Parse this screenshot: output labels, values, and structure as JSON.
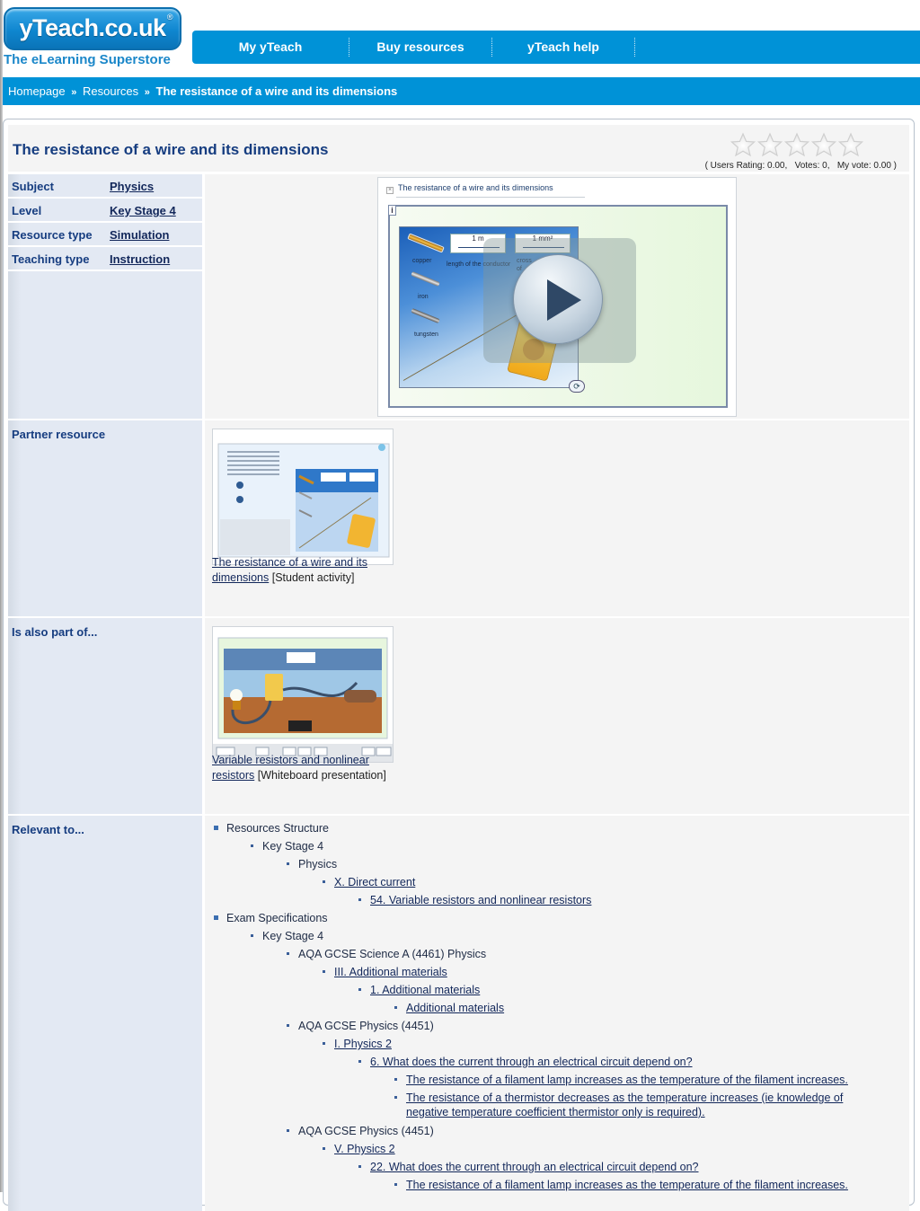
{
  "logo": {
    "text": "yTeach.co.uk",
    "reg": "®",
    "tagline": "The eLearning Superstore"
  },
  "topnav": {
    "items": [
      "My yTeach",
      "Buy resources",
      "yTeach help"
    ]
  },
  "breadcrumb": {
    "items": [
      "Homepage",
      "Resources"
    ],
    "separator": "»",
    "current": "The resistance of a wire and its dimensions"
  },
  "colors": {
    "brand_blue": "#0092d7",
    "title_navy": "#163d80",
    "label_bg": "#e3e9f3",
    "content_bg": "#f4f4f4"
  },
  "resource": {
    "title": "The resistance of a wire and its dimensions",
    "rating": {
      "stars_total": 5,
      "stars_filled": 0,
      "text": "( Users Rating: 0.00,   Votes: 0,   My vote: 0.00 )"
    },
    "properties": [
      {
        "label": "Subject",
        "value": "Physics"
      },
      {
        "label": "Level",
        "value": "Key Stage 4"
      },
      {
        "label": "Resource type",
        "value": "Simulation"
      },
      {
        "label": "Teaching type",
        "value": "Instruction"
      }
    ],
    "preview": {
      "title": "The resistance of a wire and its dimensions",
      "info_icon": "i",
      "materials": [
        "copper",
        "iron",
        "tungsten"
      ],
      "length_value": "1 m",
      "length_label": "length of the conductor",
      "area_value": "1 mm²",
      "area_label": "cross",
      "area_label_2": "of"
    }
  },
  "sections": {
    "partner": {
      "label": "Partner resource",
      "link": "The resistance of a wire and its dimensions",
      "link_line1": "The resistance of a wire and its",
      "link_line2": "dimensions",
      "type": "[Student activity]"
    },
    "part_of": {
      "label": "Is also part of...",
      "link_line1": "Variable resistors and nonlinear",
      "link_line2": "resistors",
      "type": "[Whiteboard presentation]"
    },
    "relevant": {
      "label": "Relevant to...",
      "tree": [
        {
          "level": 0,
          "text": "Resources Structure",
          "link": false
        },
        {
          "level": 1,
          "text": "Key Stage 4",
          "link": false
        },
        {
          "level": 2,
          "text": "Physics",
          "link": false
        },
        {
          "level": 3,
          "text": "X. Direct current",
          "link": true
        },
        {
          "level": 4,
          "text": "54. Variable resistors and nonlinear resistors",
          "link": true
        },
        {
          "level": 0,
          "text": "Exam Specifications",
          "link": false
        },
        {
          "level": 1,
          "text": "Key Stage 4",
          "link": false
        },
        {
          "level": 2,
          "text": "AQA GCSE Science A (4461) Physics",
          "link": false
        },
        {
          "level": 3,
          "text": "III. Additional materials",
          "link": true
        },
        {
          "level": 4,
          "text": "1. Additional materials",
          "link": true
        },
        {
          "level": 5,
          "text": "Additional materials",
          "link": true
        },
        {
          "level": 2,
          "text": "AQA GCSE Physics (4451)",
          "link": false
        },
        {
          "level": 3,
          "text": "I. Physics 2",
          "link": true
        },
        {
          "level": 4,
          "text": "6. What does the current through an electrical circuit depend on?",
          "link": true
        },
        {
          "level": 5,
          "text": "The resistance of a filament lamp increases as the temperature of the filament increases.",
          "link": true
        },
        {
          "level": 5,
          "text": "The resistance of a thermistor decreases as the temperature increases (ie knowledge of",
          "text2": "negative temperature coefficient thermistor only is required).",
          "link": true
        },
        {
          "level": 2,
          "text": "AQA GCSE Physics (4451)",
          "link": false
        },
        {
          "level": 3,
          "text": "V. Physics 2",
          "link": true
        },
        {
          "level": 4,
          "text": "22. What does the current through an electrical circuit depend on?",
          "link": true
        },
        {
          "level": 5,
          "text": "The resistance of a filament lamp increases as the temperature of the filament increases.",
          "link": true
        }
      ]
    }
  }
}
